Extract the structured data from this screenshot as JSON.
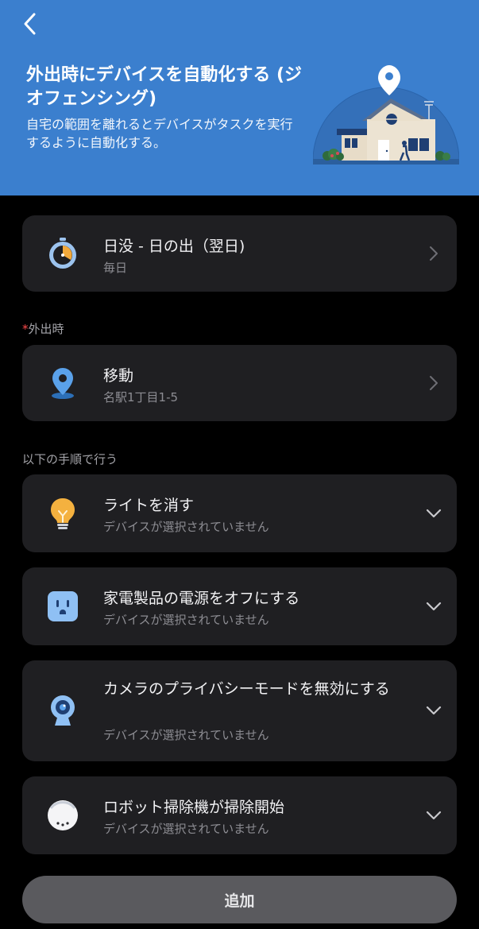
{
  "header": {
    "title": "外出時にデバイスを自動化する (ジオフェンシング)",
    "description": "自宅の範囲を離れるとデバイスがタスクを実行するように自動化する。",
    "bg_color": "#3b7fce"
  },
  "schedule": {
    "title": "日没 - 日の出（翌日)",
    "subtitle": "毎日"
  },
  "leave_section": {
    "required_mark": "*",
    "label": "外出時"
  },
  "location": {
    "title": "移動",
    "subtitle": "名駅1丁目1-5"
  },
  "steps_section": {
    "label": "以下の手順で行う"
  },
  "actions": [
    {
      "title": "ライトを消す",
      "subtitle": "デバイスが選択されていません",
      "icon": "lightbulb-icon"
    },
    {
      "title": "家電製品の電源をオフにする",
      "subtitle": "デバイスが選択されていません",
      "icon": "power-outlet-icon"
    },
    {
      "title": "カメラのプライバシーモードを無効にする",
      "subtitle": "デバイスが選択されていません",
      "icon": "camera-icon"
    },
    {
      "title": "ロボット掃除機が掃除開始",
      "subtitle": "デバイスが選択されていません",
      "icon": "robot-vacuum-icon"
    }
  ],
  "add_button": {
    "label": "追加"
  }
}
